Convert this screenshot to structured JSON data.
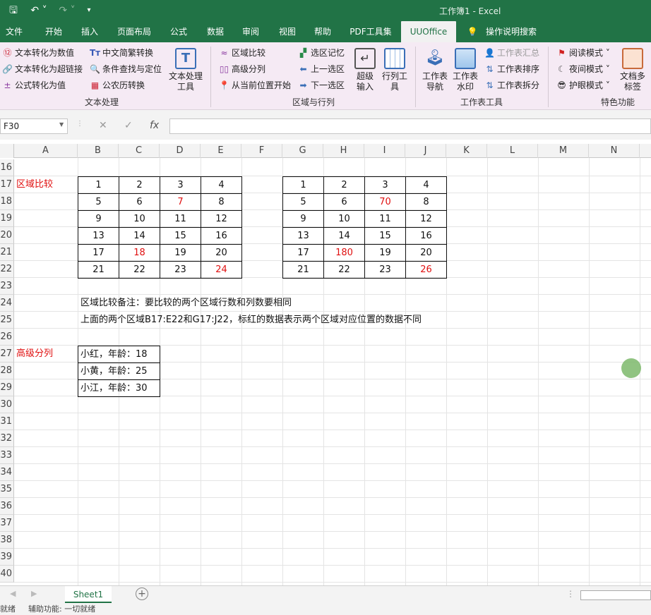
{
  "titlebar": {
    "title": "工作簿1 - Excel"
  },
  "tabs": [
    "文件",
    "开始",
    "插入",
    "页面布局",
    "公式",
    "数据",
    "审阅",
    "视图",
    "帮助",
    "PDF工具集",
    "UUOffice",
    "操作说明搜索"
  ],
  "ribbon": {
    "text_group": {
      "items": [
        "文本转化为数值",
        "文本转化为超链接",
        "公式转化为值",
        "中文简繁转换",
        "条件查找与定位",
        "公农历转换"
      ],
      "big": "文本处理工具",
      "label": "文本处理"
    },
    "range_group": {
      "items": [
        "区域比较",
        "高级分列",
        "从当前位置开始",
        "选区记忆",
        "上一选区",
        "下一选区"
      ],
      "big1": "超级输入",
      "big2": "行列工具",
      "label": "区域与行列"
    },
    "sheet_group": {
      "big1": "工作表导航",
      "big2": "工作表水印",
      "items": [
        "工作表汇总",
        "工作表排序",
        "工作表拆分"
      ],
      "label": "工作表工具"
    },
    "feature_group": {
      "items": [
        "阅读模式",
        "夜间模式",
        "护眼模式"
      ],
      "big": "文档多标签",
      "label": "特色功能"
    }
  },
  "formula": {
    "namebox": "F30",
    "fx": "fx"
  },
  "columns": [
    "A",
    "B",
    "C",
    "D",
    "E",
    "F",
    "G",
    "H",
    "I",
    "J",
    "K",
    "L",
    "M",
    "N"
  ],
  "rows": [
    "16",
    "17",
    "18",
    "19",
    "20",
    "21",
    "22",
    "23",
    "24",
    "25",
    "26",
    "27",
    "28",
    "29",
    "30",
    "31",
    "32",
    "33",
    "34",
    "35",
    "36",
    "37",
    "38",
    "39",
    "40"
  ],
  "sheet": {
    "label_compare": "区域比较",
    "table1": [
      [
        "1",
        "2",
        "3",
        "4"
      ],
      [
        "5",
        "6",
        "7",
        "8"
      ],
      [
        "9",
        "10",
        "11",
        "12"
      ],
      [
        "13",
        "14",
        "15",
        "16"
      ],
      [
        "17",
        "18",
        "19",
        "20"
      ],
      [
        "21",
        "22",
        "23",
        "24"
      ]
    ],
    "table2": [
      [
        "1",
        "2",
        "3",
        "4"
      ],
      [
        "5",
        "6",
        "70",
        "8"
      ],
      [
        "9",
        "10",
        "11",
        "12"
      ],
      [
        "13",
        "14",
        "15",
        "16"
      ],
      [
        "17",
        "180",
        "19",
        "20"
      ],
      [
        "21",
        "22",
        "23",
        "26"
      ]
    ],
    "note1": "区域比较备注：要比较的两个区域行数和列数要相同",
    "note2": "上面的两个区域B17:E22和G17:J22，标红的数据表示两个区域对应位置的数据不同",
    "label_split": "高级分列",
    "split": [
      "小红，年龄：18",
      "小黄，年龄：25",
      "小江，年龄：30"
    ]
  },
  "sheet_tab": "Sheet1",
  "status": {
    "ready": "就绪",
    "access": "辅助功能: 一切就绪"
  },
  "colors": {
    "accent": "#217346",
    "highlight": "#e01010"
  }
}
